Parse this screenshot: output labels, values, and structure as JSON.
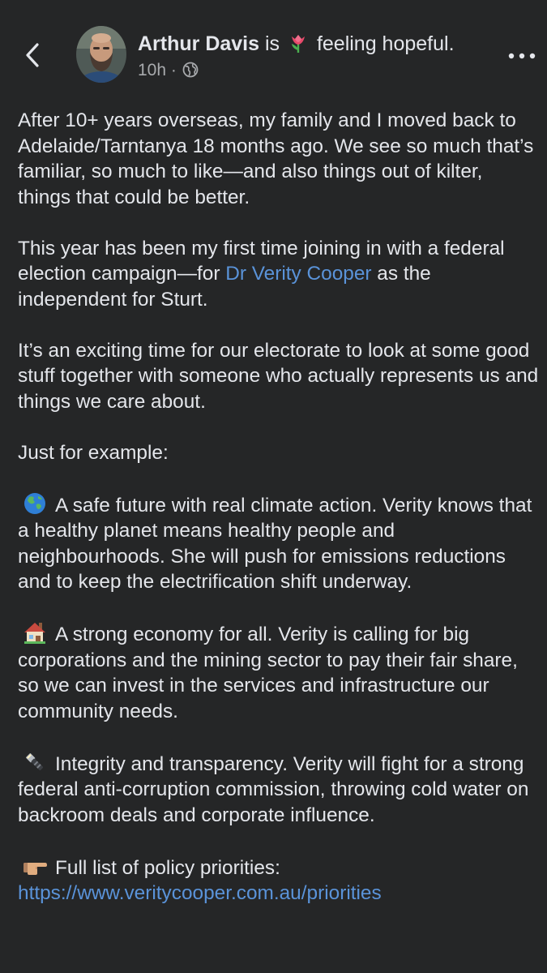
{
  "header": {
    "author_name": "Arthur Davis",
    "is_word": " is ",
    "feeling_text": " feeling hopeful.",
    "feeling_icon": "tulip-icon",
    "time": "10h",
    "separator": " · ",
    "audience_icon": "globe-icon",
    "back_icon": "chevron-left-icon",
    "more_icon": "more-horizontal-icon"
  },
  "post": {
    "p1": "After 10+ years overseas, my family and I moved back to Adelaide/Tarntanya 18 months ago. We see so much that’s familiar, so much to like—and also things out of kilter, things that could be better.",
    "p2_before": "This year has been my first time joining in with a federal election campaign—for ",
    "p2_link": "Dr Verity Cooper",
    "p2_after": " as the independent for Sturt.",
    "p3": "It’s an exciting time for our electorate to look at some good stuff together with someone who actually represents us and things we care about.",
    "p4": "Just for example:",
    "item1": "A safe future with real climate action. Verity knows that a healthy planet means healthy people and neighbourhoods. She will push for emissions reductions and to keep the electrification shift underway.",
    "item2": "A strong economy for all. Verity is calling for big corporations and the mining sector to pay their fair share, so we can invest in the services and infrastructure our community needs.",
    "item3": "Integrity and transparency. Verity will fight for a strong federal anti-corruption commission, throwing cold water on backroom deals and corporate influence.",
    "item4_text": "Full list of policy priorities: ",
    "item4_link": "https://www.veritycooper.com.au/priorities",
    "icons": [
      "globe-asia-icon",
      "house-icon",
      "flashlight-icon",
      "pointing-hand-icon"
    ]
  },
  "colors": {
    "background": "#252627",
    "text": "#e4e6eb",
    "muted": "#a8aaad",
    "link": "#5a93d9"
  }
}
